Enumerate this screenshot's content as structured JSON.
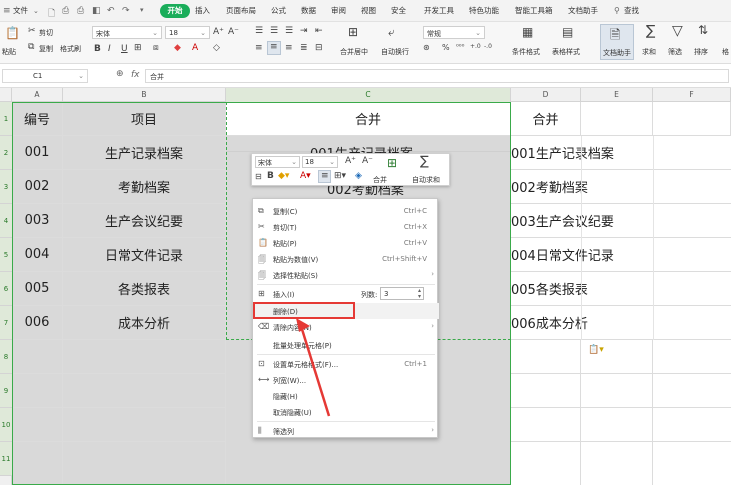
{
  "menubar": {
    "file": "文件",
    "start": "开始",
    "items": [
      "插入",
      "页面布局",
      "公式",
      "数据",
      "审阅",
      "视图",
      "安全",
      "开发工具",
      "特色功能",
      "智能工具箱",
      "文档助手"
    ],
    "search": "查找"
  },
  "ribbon": {
    "paste": "粘贴",
    "cut": "剪切",
    "copy": "复制",
    "format_painter": "格式刷",
    "font_name": "宋体",
    "font_size": "18",
    "merge_center": "合并居中",
    "auto_wrap": "自动换行",
    "number_format": "常规",
    "conditional_format": "条件格式",
    "table_style": "表格样式",
    "doc_helper": "文档助手",
    "sum": "求和",
    "filter": "筛选",
    "sort": "排序",
    "format": "格"
  },
  "formula_bar": {
    "cell_ref": "C1",
    "fx": "fx",
    "value": "合并"
  },
  "columns": [
    "A",
    "B",
    "C",
    "D",
    "E",
    "F"
  ],
  "rows": [
    "1",
    "2",
    "3",
    "4",
    "5",
    "6",
    "7",
    "8",
    "9",
    "10",
    "11"
  ],
  "table": {
    "header": {
      "a": "编号",
      "b": "项目",
      "c": "合并",
      "d": "合并"
    },
    "rows": [
      {
        "a": "001",
        "b": "生产记录档案",
        "d": "001生产记录档案"
      },
      {
        "a": "002",
        "b": "考勤档案",
        "d": "002考勤档案"
      },
      {
        "a": "003",
        "b": "生产会议纪要",
        "d": "003生产会议纪要"
      },
      {
        "a": "004",
        "b": "日常文件记录",
        "d": "004日常文件记录"
      },
      {
        "a": "005",
        "b": "各类报表",
        "d": "005各类报表"
      },
      {
        "a": "006",
        "b": "成本分析",
        "d": "006成本分析"
      }
    ],
    "c_row1": "001生产记录档案",
    "c_row2": "002考勤档案"
  },
  "mini_toolbar": {
    "font_name": "宋体",
    "font_size": "18",
    "bold": "B",
    "merge": "合并",
    "autosum": "自动求和"
  },
  "context_menu": {
    "items": [
      {
        "label": "复制(C)",
        "shortcut": "Ctrl+C",
        "icon": "copy-icon"
      },
      {
        "label": "剪切(T)",
        "shortcut": "Ctrl+X",
        "icon": "scissors-icon"
      },
      {
        "label": "粘贴(P)",
        "shortcut": "Ctrl+V",
        "icon": "paste-icon"
      },
      {
        "label": "粘贴为数值(V)",
        "shortcut": "Ctrl+Shift+V",
        "icon": "paste-values-icon"
      },
      {
        "label": "选择性粘贴(S)",
        "shortcut": "",
        "icon": "paste-special-icon"
      },
      {
        "label": "插入(I)",
        "shortcut": "",
        "icon": "insert-icon"
      },
      {
        "label": "删除(D)",
        "shortcut": "",
        "icon": ""
      },
      {
        "label": "清除内容(N)",
        "shortcut": "",
        "icon": "eraser-icon"
      },
      {
        "label": "批量处理单元格(P)",
        "shortcut": "",
        "icon": ""
      },
      {
        "label": "设置单元格格式(F)...",
        "shortcut": "Ctrl+1",
        "icon": "format-cells-icon"
      },
      {
        "label": "列宽(W)...",
        "shortcut": "",
        "icon": "column-width-icon"
      },
      {
        "label": "隐藏(H)",
        "shortcut": "",
        "icon": ""
      },
      {
        "label": "取消隐藏(U)",
        "shortcut": "",
        "icon": ""
      },
      {
        "label": "筛选列",
        "shortcut": "",
        "icon": "filter-column-icon"
      }
    ],
    "insert_count_label": "列数:",
    "insert_count_value": "3"
  },
  "colors": {
    "accent_green": "#1aad5a",
    "highlight_red": "#e53935",
    "selection_border": "#3aaa4a"
  }
}
